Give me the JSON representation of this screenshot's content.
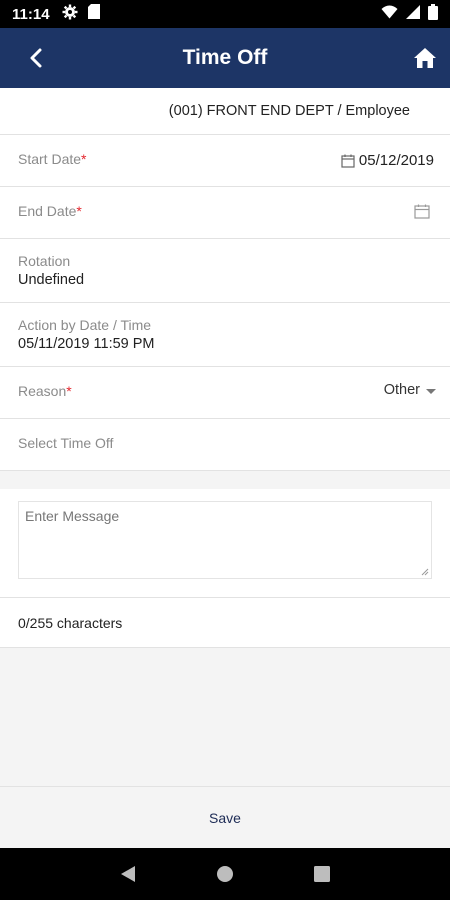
{
  "status_bar": {
    "time": "11:14"
  },
  "header": {
    "title": "Time Off"
  },
  "department": "(001) FRONT END DEPT / Employee",
  "fields": {
    "start_date": {
      "label": "Start Date",
      "required_mark": "*",
      "value": "05/12/2019"
    },
    "end_date": {
      "label": "End Date",
      "required_mark": "*",
      "value": ""
    },
    "rotation": {
      "label": "Rotation",
      "value": "Undefined"
    },
    "action_by": {
      "label": "Action by Date / Time",
      "value": "05/11/2019 11:59 PM"
    },
    "reason": {
      "label": "Reason",
      "required_mark": "*",
      "value": "Other"
    },
    "select_time_off": {
      "label": "Select Time Off"
    }
  },
  "message": {
    "placeholder": "Enter Message",
    "char_count": "0/255 characters"
  },
  "footer": {
    "save_label": "Save"
  },
  "colors": {
    "header_bg": "#1d3566",
    "required": "#e3262d",
    "page_bg": "#f4f4f4"
  }
}
